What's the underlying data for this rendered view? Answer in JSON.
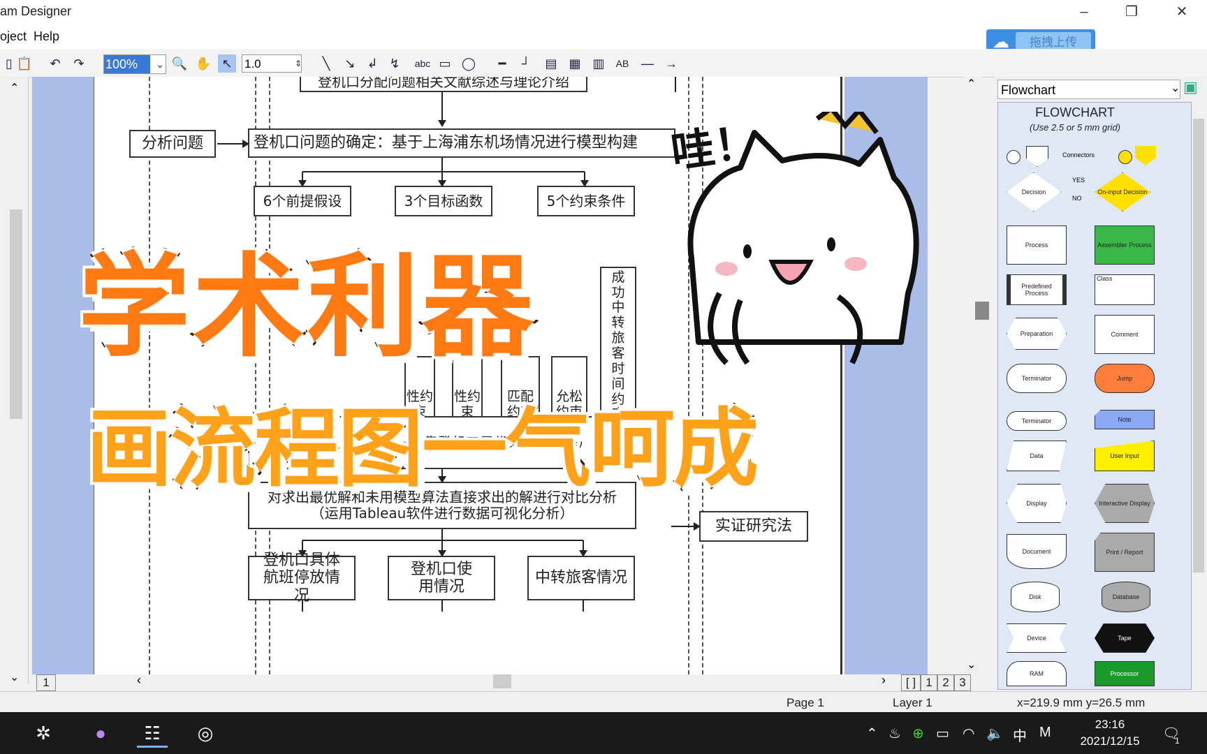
{
  "window": {
    "title": "am Designer"
  },
  "menu": {
    "items": [
      "oject",
      "Help"
    ]
  },
  "upload": {
    "label": "拖拽上传"
  },
  "toolbar": {
    "zoom": "100%",
    "line_width": "1.0",
    "text_tool": "abc",
    "text_fmt": "AB"
  },
  "flowchart": {
    "top_cut": "登机口分配问题相关文献综述与理论介绍",
    "analyze": "分析问题",
    "confirm": "登机口问题的确定：基于上海浦东机场情况进行模型构建",
    "a1": "6个前提假设",
    "a2": "3个目标函数",
    "a3": "5个约束条件",
    "c1": "性约束",
    "c2": "性约束",
    "c3": "匹配约束",
    "c4": "允松约束",
    "c5": "成功中转旅客时间约束",
    "sched": "的非支配排序遗班停靠登机口最优方案件编程）",
    "compare1": "对求出最优解和未用模型算法直接求出的解进行对比分析",
    "compare2": "（运用Tableau软件进行数据可视化分析）",
    "empirical": "实证研究法",
    "r1": "登机口具体航班停放情况",
    "r2": "登机口使用情况",
    "r3": "中转旅客情况"
  },
  "overlay": {
    "title1": "学术利器",
    "title2": "画流程图一气呵成",
    "wow": "哇！"
  },
  "library": {
    "selected": "Flowchart",
    "header": "FLOWCHART",
    "subheader": "(Use 2.5 or 5 mm grid)",
    "shapes": [
      "Connectors",
      "Decision",
      "YES",
      "NO",
      "On-input Decision",
      "Process",
      "Assembler Process",
      "Predefined Process",
      "Class",
      "Preparation",
      "Comment",
      "Terminator",
      "Jump",
      "Terminator",
      "Note",
      "Data",
      "User Input",
      "Display",
      "Interactive Display",
      "Document",
      "Print / Report",
      "Disk",
      "Database",
      "Device",
      "Tape",
      "RAM",
      "Processor"
    ]
  },
  "pages": {
    "tabs": [
      "1",
      "[ ]",
      "1",
      "2",
      "3"
    ]
  },
  "status": {
    "page": "Page 1",
    "layer": "Layer 1",
    "coords": "x=219.9 mm  y=26.5 mm"
  },
  "taskbar": {
    "time": "23:16",
    "date": "2021/12/15",
    "ime": "中",
    "badge": "1"
  }
}
